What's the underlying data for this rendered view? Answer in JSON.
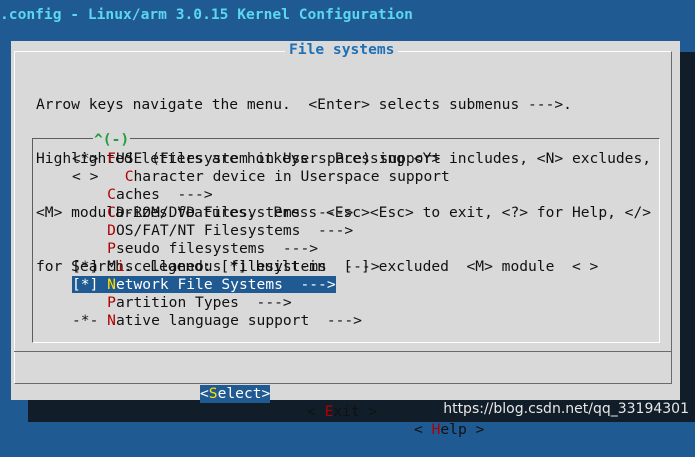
{
  "window": {
    "title": ".config - Linux/arm 3.0.15 Kernel Configuration"
  },
  "dialog": {
    "title": "File systems",
    "help_lines": [
      "Arrow keys navigate the menu.  <Enter> selects submenus --->.",
      "Highlighted letters are hotkeys.  Pressing <Y> includes, <N> excludes,",
      "<M> modularizes features.  Press <Esc><Esc> to exit, <?> for Help, </>",
      "for Search.  Legend: [*] built-in  [ ] excluded  <M> module  < >"
    ],
    "scroll_indicator": "^(-)",
    "menu": [
      {
        "prefix": "<*> ",
        "hot": "F",
        "rest": "USE (Filesystem in Userspace) support",
        "selected": false
      },
      {
        "prefix": "< >   ",
        "hot": "C",
        "rest": "haracter device in Userspace support",
        "selected": false
      },
      {
        "prefix": "    ",
        "hot": "C",
        "rest": "aches  --->",
        "selected": false
      },
      {
        "prefix": "    ",
        "hot": "C",
        "rest": "D-ROM/DVD Filesystems  --->",
        "selected": false
      },
      {
        "prefix": "    ",
        "hot": "D",
        "rest": "OS/FAT/NT Filesystems  --->",
        "selected": false
      },
      {
        "prefix": "    ",
        "hot": "P",
        "rest": "seudo filesystems  --->",
        "selected": false
      },
      {
        "prefix": "[*] M",
        "hot": "i",
        "rest": "scellaneous filesystems  --->",
        "selected": false
      },
      {
        "prefix": "[*] ",
        "hot": "N",
        "rest": "etwork File Systems  --->",
        "selected": true
      },
      {
        "prefix": "    ",
        "hot": "P",
        "rest": "artition Types  --->",
        "selected": false
      },
      {
        "prefix": "-*- ",
        "hot": "N",
        "rest": "ative language support  --->",
        "selected": false
      }
    ],
    "buttons": {
      "select": {
        "open": "<",
        "hot": "S",
        "rest": "elect>"
      },
      "exit": {
        "open": "< ",
        "hot": "E",
        "rest": "xit >"
      },
      "help": {
        "open": "< ",
        "hot": "H",
        "rest": "elp >"
      }
    }
  },
  "watermark": "https://blog.csdn.net/qq_33194301",
  "colors": {
    "background": "#1f5a93",
    "dialog": "#d9d9d9",
    "title": "#5bd8f0",
    "hotkey": "#b00000",
    "hotkey_selected": "#ffe000"
  }
}
